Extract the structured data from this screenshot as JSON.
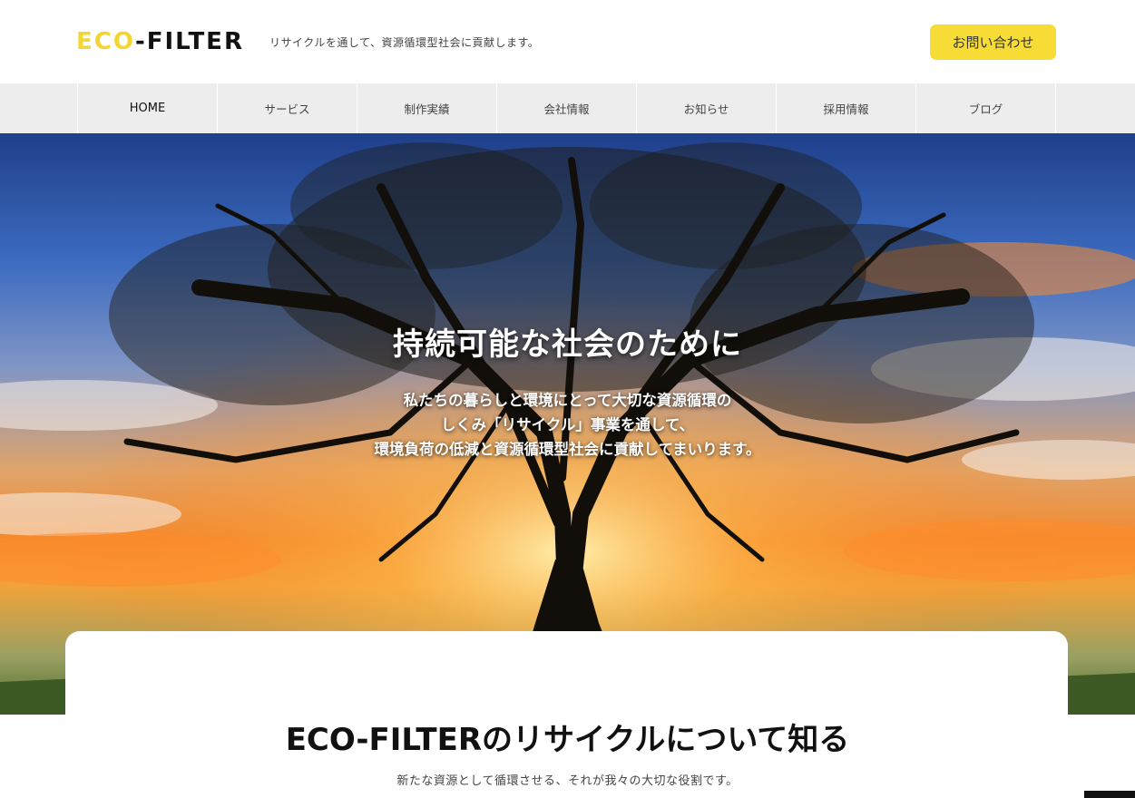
{
  "header": {
    "logo_eco": "ECO",
    "logo_filter": "-FILTER",
    "tagline": "リサイクルを通して、資源循環型社会に貢献します。",
    "contact_label": "お問い合わせ"
  },
  "nav": {
    "items": [
      {
        "label": "HOME"
      },
      {
        "label": "サービス"
      },
      {
        "label": "制作実績"
      },
      {
        "label": "会社情報"
      },
      {
        "label": "お知らせ"
      },
      {
        "label": "採用情報"
      },
      {
        "label": "ブログ"
      }
    ]
  },
  "hero": {
    "title": "持続可能な社会のために",
    "line1": "私たちの暮らしと環境にとって大切な資源循環の",
    "line2": "しくみ「リサイクル」事業を通して、",
    "line3": "環境負荷の低減と資源循環型社会に貢献してまいります。"
  },
  "section": {
    "title": "ECO-FILTERのリサイクルについて知る",
    "subtitle": "新たな資源として循環させる、それが我々の大切な役割です。"
  },
  "colors": {
    "accent": "#f8dc36",
    "nav_bg": "#ededed"
  }
}
